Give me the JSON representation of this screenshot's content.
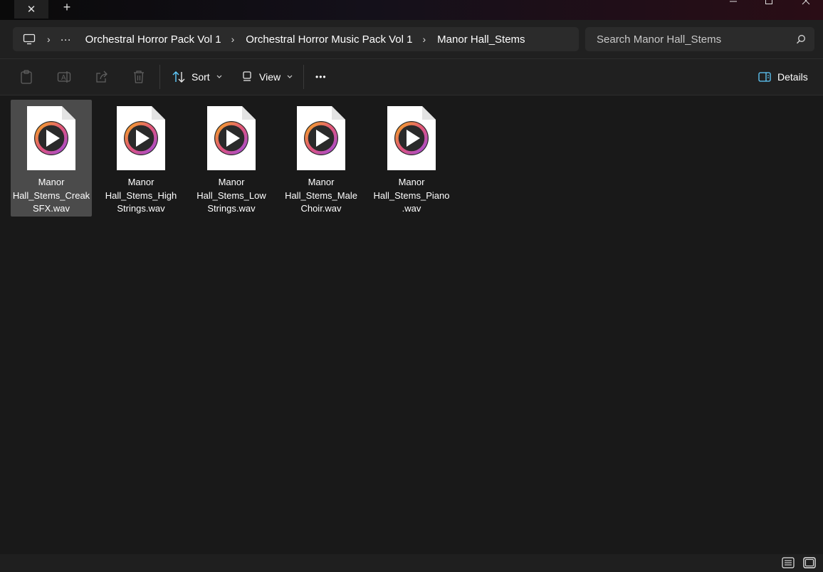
{
  "titlebar": {
    "close_tab_glyph": "✕",
    "new_tab_glyph": "+"
  },
  "breadcrumb": {
    "overflow": "···",
    "items": [
      "Orchestral Horror Pack Vol 1",
      "Orchestral Horror Music Pack Vol 1",
      "Manor Hall_Stems"
    ]
  },
  "search": {
    "placeholder": "Search Manor Hall_Stems"
  },
  "toolbar": {
    "sort_label": "Sort",
    "view_label": "View",
    "more_label": "•••",
    "details_label": "Details"
  },
  "files": [
    {
      "name": "Manor Hall_Stems_Creak SFX.wav",
      "line1": "Manor",
      "line2": "Hall_Stems_Creak",
      "line3": "SFX.wav",
      "selected": true
    },
    {
      "name": "Manor Hall_Stems_High Strings.wav",
      "line1": "Manor",
      "line2": "Hall_Stems_High",
      "line3": "Strings.wav",
      "selected": false
    },
    {
      "name": "Manor Hall_Stems_Low Strings.wav",
      "line1": "Manor",
      "line2": "Hall_Stems_Low",
      "line3": "Strings.wav",
      "selected": false
    },
    {
      "name": "Manor Hall_Stems_Male Choir.wav",
      "line1": "Manor",
      "line2": "Hall_Stems_Male",
      "line3": "Choir.wav",
      "selected": false
    },
    {
      "name": "Manor Hall_Stems_Piano.wav",
      "line1": "Manor",
      "line2": "Hall_Stems_Piano",
      "line3": ".wav",
      "selected": false
    }
  ],
  "icons": {
    "computer": "computer-icon",
    "paste": "paste-icon",
    "rename": "rename-icon",
    "share": "share-icon",
    "delete": "trash-icon",
    "sort": "sort-arrows-icon",
    "view": "view-icon",
    "details": "details-pane-icon",
    "file": "media-audio-file-icon"
  },
  "colors": {
    "accent_blue": "#60cdff",
    "play_ring_start": "#f5a623",
    "play_ring_end": "#b04dcf",
    "selection": "#4b4b4b"
  }
}
